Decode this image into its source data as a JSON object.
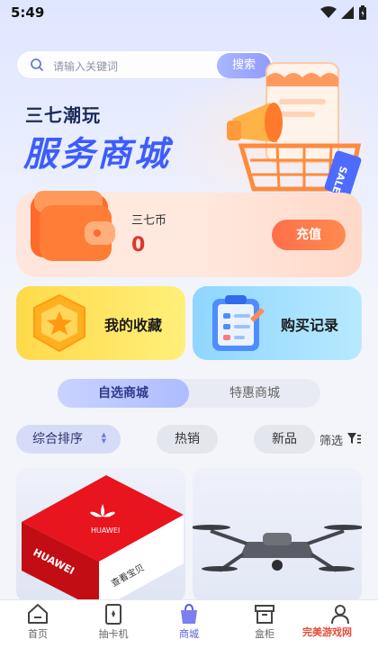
{
  "status_bar": {
    "time": "5:49"
  },
  "search": {
    "placeholder": "请输入关键词",
    "button_label": "搜索"
  },
  "brand": {
    "subtitle": "三七潮玩",
    "title": "服务商城"
  },
  "coin_card": {
    "label": "三七币",
    "value": "0",
    "recharge_label": "充值"
  },
  "tiles": {
    "favorites_label": "我的收藏",
    "purchases_label": "购买记录"
  },
  "segment": {
    "tabs": [
      "自选商城",
      "特惠商城"
    ],
    "active_index": 0
  },
  "sort": {
    "composite_label": "综合排序",
    "hot_label": "热销",
    "new_label": "新品",
    "filter_label": "筛选"
  },
  "products": [
    {
      "box_brand": "HUAWEI",
      "box_caption": "查看宝贝",
      "image": "red-gift-box"
    },
    {
      "image": "drone"
    }
  ],
  "bottom_nav": {
    "items": [
      {
        "label": "首页",
        "icon": "home-icon"
      },
      {
        "label": "抽卡机",
        "icon": "card-machine-icon"
      },
      {
        "label": "商城",
        "icon": "shopping-bag-icon",
        "active": true
      },
      {
        "label": "盒柜",
        "icon": "box-cabinet-icon"
      },
      {
        "label": "我的",
        "icon": "profile-icon"
      }
    ]
  },
  "watermark": "完美游戏网",
  "colors": {
    "accent": "#5a5fe0",
    "brand_blue": "#3d5cff",
    "coin_red": "#e0352b",
    "recharge_orange": "#ff7a4c"
  }
}
